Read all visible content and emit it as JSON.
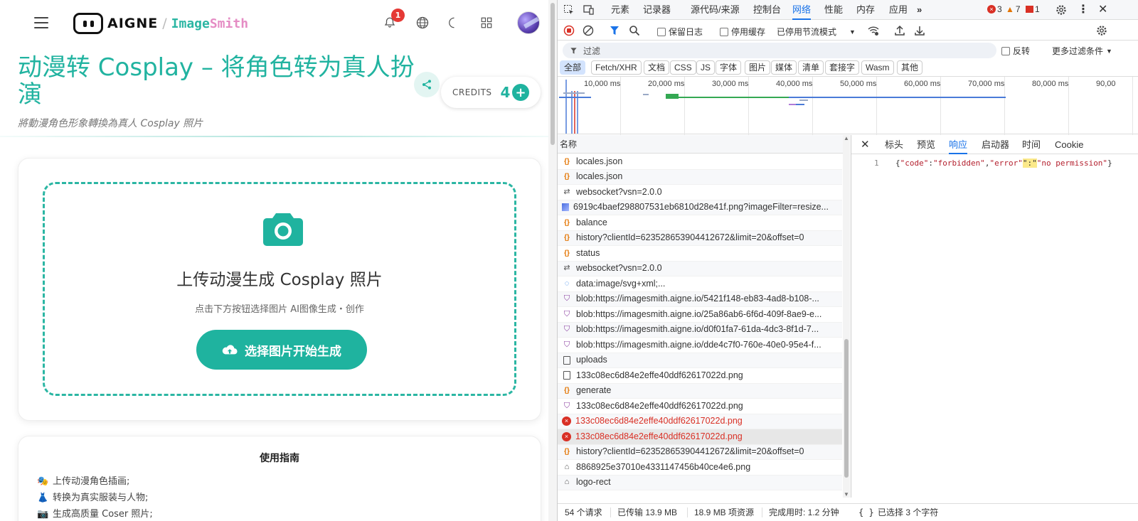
{
  "app": {
    "logo_text": "AIGNE",
    "logo_sep": "/",
    "product_a": "Image",
    "product_b": "Smith",
    "notification_count": "1",
    "title": "动漫转 Cosplay – 将角色转为真人扮演",
    "subtitle": "將動漫角色形象轉換為真人 Cosplay 照片",
    "credits_label": "CREDITS",
    "credits_value": "4",
    "upload_title": "上传动漫生成 Cosplay 照片",
    "upload_hint": "点击下方按钮选择图片 AI图像生成・创作",
    "upload_button": "选择图片开始生成",
    "guide_title": "使用指南",
    "guide_items": [
      {
        "emoji": "🎭",
        "text": "上传动漫角色插画;"
      },
      {
        "emoji": "👗",
        "text": "转换为真实服装与人物;"
      },
      {
        "emoji": "📷",
        "text": "生成高质量 Coser 照片;"
      }
    ]
  },
  "devtools": {
    "tabs": [
      "元素",
      "记录器",
      "源代码/来源",
      "控制台",
      "网络",
      "性能",
      "内存",
      "应用"
    ],
    "active_tab": "网络",
    "counts": {
      "errors": "3",
      "warnings": "7",
      "issues": "1"
    },
    "toolbar": {
      "preserve_log": "保留日志",
      "disable_cache": "停用缓存",
      "throttle": "已停用节流模式"
    },
    "filter": {
      "placeholder": "过滤",
      "invert": "反转",
      "more_filters": "更多过滤条件"
    },
    "types": [
      "全部",
      "Fetch/XHR",
      "文档",
      "CSS",
      "JS",
      "字体",
      "图片",
      "媒体",
      "清单",
      "套接字",
      "Wasm",
      "其他"
    ],
    "timeline_labels": [
      "10,000 ms",
      "20,000 ms",
      "30,000 ms",
      "40,000 ms",
      "50,000 ms",
      "60,000 ms",
      "70,000 ms",
      "80,000 ms",
      "90,00"
    ],
    "name_header": "名称",
    "requests": [
      {
        "icon": "js",
        "name": "locales.json",
        "status": "ok"
      },
      {
        "icon": "js",
        "name": "locales.json",
        "status": "ok"
      },
      {
        "icon": "ws",
        "name": "websocket?vsn=2.0.0",
        "status": "ok"
      },
      {
        "icon": "img",
        "name": "6919c4baef298807531eb6810d28e41f.png?imageFilter=resize...",
        "status": "ok"
      },
      {
        "icon": "js",
        "name": "balance",
        "status": "ok"
      },
      {
        "icon": "js",
        "name": "history?clientId=623528653904412672&limit=20&offset=0",
        "status": "ok"
      },
      {
        "icon": "js",
        "name": "status",
        "status": "ok"
      },
      {
        "icon": "ws",
        "name": "websocket?vsn=2.0.0",
        "status": "ok"
      },
      {
        "icon": "data",
        "name": "data:image/svg+xml;...",
        "status": "ok"
      },
      {
        "icon": "blob",
        "name": "blob:https://imagesmith.aigne.io/5421f148-eb83-4ad8-b108-...",
        "status": "ok"
      },
      {
        "icon": "blob",
        "name": "blob:https://imagesmith.aigne.io/25a86ab6-6f6d-409f-8ae9-e...",
        "status": "ok"
      },
      {
        "icon": "blob",
        "name": "blob:https://imagesmith.aigne.io/d0f01fa7-61da-4dc3-8f1d-7...",
        "status": "ok"
      },
      {
        "icon": "blob",
        "name": "blob:https://imagesmith.aigne.io/dde4c7f0-760e-40e0-95e4-f...",
        "status": "ok"
      },
      {
        "icon": "doc",
        "name": "uploads",
        "status": "ok"
      },
      {
        "icon": "doc",
        "name": "133c08ec6d84e2effe40ddf62617022d.png",
        "status": "ok"
      },
      {
        "icon": "js",
        "name": "generate",
        "status": "ok"
      },
      {
        "icon": "blob",
        "name": "133c08ec6d84e2effe40ddf62617022d.png",
        "status": "ok"
      },
      {
        "icon": "errx",
        "name": "133c08ec6d84e2effe40ddf62617022d.png",
        "status": "error"
      },
      {
        "icon": "errx",
        "name": "133c08ec6d84e2effe40ddf62617022d.png",
        "status": "selected"
      },
      {
        "icon": "js",
        "name": "history?clientId=623528653904412672&limit=20&offset=0",
        "status": "ok"
      },
      {
        "icon": "other",
        "name": "8868925e37010e4331147456b40ce4e6.png",
        "status": "ok"
      },
      {
        "icon": "other",
        "name": "logo-rect",
        "status": "ok"
      }
    ],
    "detail_tabs": [
      "标头",
      "预览",
      "响应",
      "启动器",
      "时间",
      "Cookie"
    ],
    "active_detail_tab": "响应",
    "response": {
      "line_no": "1",
      "open": "{",
      "k1": "\"code\"",
      "v1": "\"forbidden\"",
      "k2": "\"error\"",
      "v2": "\"no permission\"",
      "close": "}"
    },
    "status_bar": {
      "requests": "54 个请求",
      "transferred": "已传输 13.9 MB",
      "resources": "18.9 MB 项资源",
      "finish": "完成用时: 1.2 分钟",
      "selection": "已选择 3 个字符"
    }
  }
}
